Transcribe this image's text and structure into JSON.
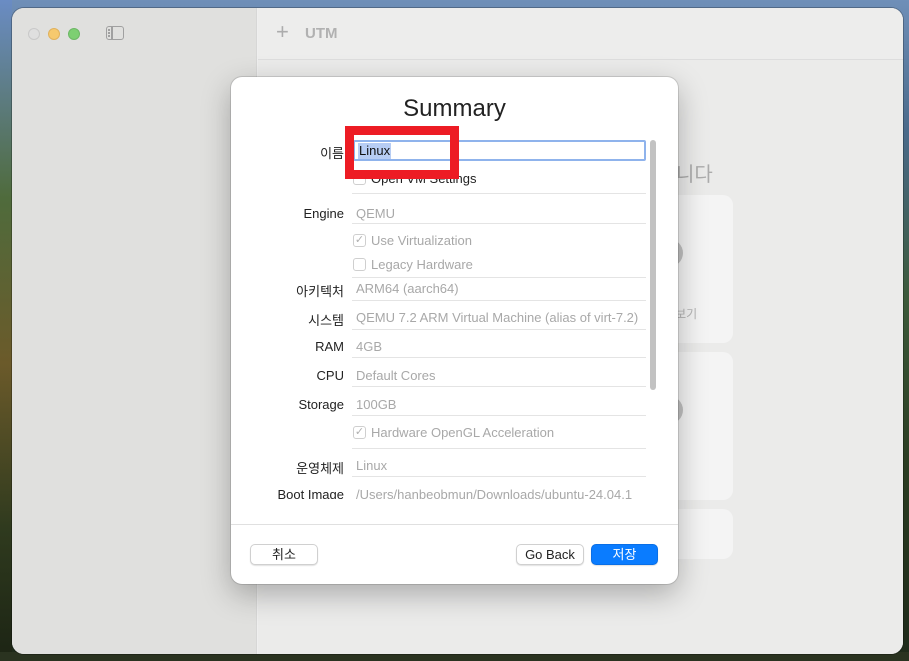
{
  "window": {
    "app_title": "UTM"
  },
  "background": {
    "heading_fragment": "니다",
    "card_1_label_fragment": "둘러보기",
    "card_2_label_fragment": "t"
  },
  "dialog": {
    "title": "Summary",
    "fields": {
      "name_label": "이름",
      "name_value": "Linux",
      "open_vm_settings": "Open VM Settings",
      "engine_label": "Engine",
      "engine_value": "QEMU",
      "use_virtualization": "Use Virtualization",
      "use_virtualization_checked": true,
      "legacy_hardware": "Legacy Hardware",
      "legacy_hardware_checked": false,
      "arch_label": "아키텍처",
      "arch_value": "ARM64 (aarch64)",
      "system_label": "시스템",
      "system_value": "QEMU 7.2 ARM Virtual Machine (alias of virt-7.2)",
      "ram_label": "RAM",
      "ram_value": "4GB",
      "cpu_label": "CPU",
      "cpu_value": "Default Cores",
      "storage_label": "Storage",
      "storage_value": "100GB",
      "opengl": "Hardware OpenGL Acceleration",
      "opengl_checked": true,
      "os_label": "운영체제",
      "os_value": "Linux",
      "boot_image_label": "Boot Image",
      "boot_image_value": "/Users/hanbeobmun/Downloads/ubuntu-24.04.1"
    },
    "buttons": {
      "cancel": "취소",
      "go_back": "Go Back",
      "save": "저장"
    }
  },
  "colors": {
    "accent": "#0a7cff",
    "highlight_box": "#ed1c24",
    "selection": "#b7cdf4"
  }
}
